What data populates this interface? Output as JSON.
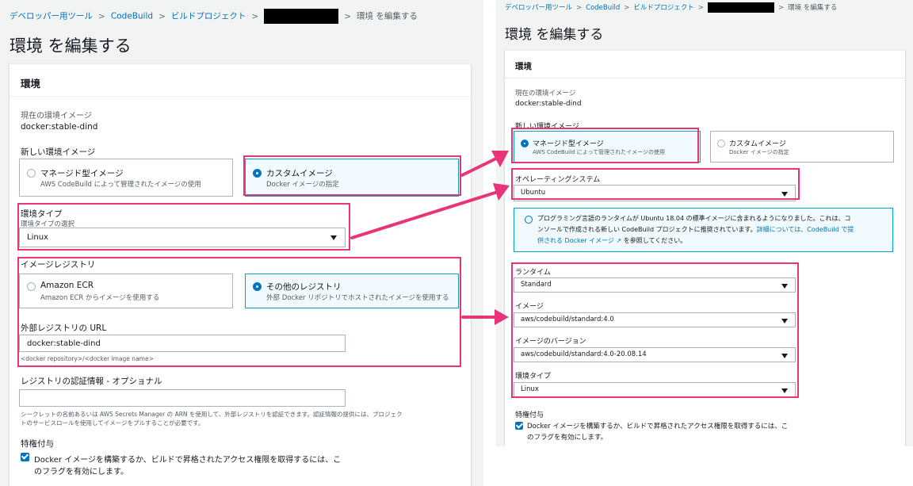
{
  "colors": {
    "accent": "#0073bb",
    "highlight": "#e8357a",
    "info_bg": "#f1faff",
    "page_bg": "#f2f3f3"
  },
  "left": {
    "breadcrumb": [
      "デベロッパー用ツール",
      "CodeBuild",
      "ビルドプロジェクト",
      "環境 を編集する"
    ],
    "page_title": "環境 を編集する",
    "card_title": "環境",
    "current_image_label": "現在の環境イメージ",
    "current_image_value": "docker:stable-dind",
    "new_image_label": "新しい環境イメージ",
    "managed_tile": {
      "title": "マネージド型イメージ",
      "desc": "AWS CodeBuild によって管理されたイメージの使用",
      "selected": false
    },
    "custom_tile": {
      "title": "カスタムイメージ",
      "desc": "Docker イメージの指定",
      "selected": true
    },
    "env_type_label": "環境タイプ",
    "env_type_desc": "環境タイプの選択",
    "env_type_value": "Linux",
    "registry_label": "イメージレジストリ",
    "ecr_tile": {
      "title": "Amazon ECR",
      "desc": "Amazon ECR からイメージを使用する",
      "selected": false
    },
    "other_tile": {
      "title": "その他のレジストリ",
      "desc": "外部 Docker リポジトリでホストされたイメージを使用する",
      "selected": true
    },
    "ext_url_label": "外部レジストリの URL",
    "ext_url_value": "docker:stable-dind",
    "ext_url_hint": "<docker repository>/<docker image name>",
    "cred_label": "レジストリの認証情報 - オプショナル",
    "cred_value": "",
    "cred_desc_line1": "シークレットの名前あるいは AWS Secrets Manager の ARN を使用して、外部レジストリを認証できます。認証情報の提供には、プロジェク",
    "cred_desc_line2": "トのサービスロールを使用してイメージをプルすることが必要です。",
    "privileged_label": "特権付与",
    "privileged_text_line1": "Docker イメージを構築するか、ビルドで昇格されたアクセス権限を取得するには、こ",
    "privileged_text_line2": "のフラグを有効にします。",
    "privileged_checked": true
  },
  "right": {
    "breadcrumb": [
      "デベロッパー用ツール",
      "CodeBuild",
      "ビルドプロジェクト",
      "環境 を編集する"
    ],
    "page_title": "環境 を編集する",
    "card_title": "環境",
    "current_image_label": "現在の環境イメージ",
    "current_image_value": "docker:stable-dind",
    "new_image_label": "新しい環境イメージ",
    "managed_tile": {
      "title": "マネージド型イメージ",
      "desc": "AWS CodeBuild によって管理されたイメージの使用",
      "selected": true
    },
    "custom_tile": {
      "title": "カスタムイメージ",
      "desc": "Docker イメージの指定",
      "selected": false
    },
    "os_label": "オペレーティングシステム",
    "os_value": "Ubuntu",
    "info_line1": "プログラミング言語のランタイムが Ubuntu 18.04 の標準イメージに含まれるようになりました。これは、コ",
    "info_line2_text": "ンソールで作成される新しい CodeBuild プロジェクトに推奨されています。",
    "info_line2_link": "詳細については、CodeBuild で提",
    "info_line3_link": "供される Docker イメージ",
    "info_line3_text": " を参照してください。",
    "runtime_label": "ランタイム",
    "runtime_value": "Standard",
    "image_label": "イメージ",
    "image_value": "aws/codebuild/standard:4.0",
    "image_version_label": "イメージのバージョン",
    "image_version_value": "aws/codebuild/standard:4.0-20.08.14",
    "env_type_label": "環境タイプ",
    "env_type_value": "Linux",
    "privileged_label": "特権付与",
    "privileged_text_line1": "Docker イメージを構築するか、ビルドで昇格されたアクセス権限を取得するには、こ",
    "privileged_text_line2": "のフラグを有効にします。",
    "privileged_checked": true
  }
}
